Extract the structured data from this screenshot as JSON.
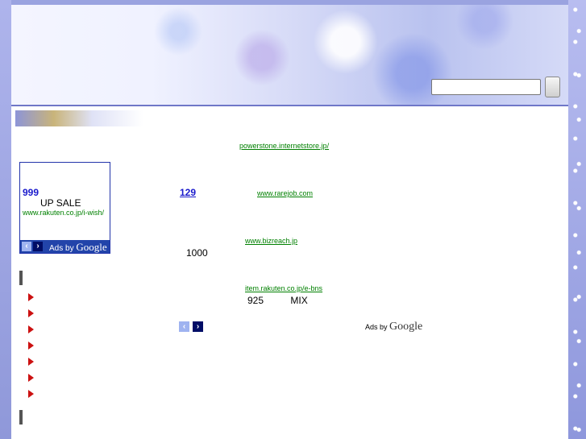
{
  "search": {
    "value": "",
    "placeholder": ""
  },
  "sidebar_ad": {
    "price": "999",
    "sale": "UP SALE",
    "url": "www.rakuten.co.jp/i-wish/",
    "prev_icon": "‹",
    "next_icon": "›",
    "ads_by": "Ads by",
    "google": "Google"
  },
  "menu": {
    "item_count": 7
  },
  "ads": [
    {
      "title": "",
      "url": "powerstone.internetstore.jp/",
      "desc": ""
    },
    {
      "title": "129",
      "url": "www.rarejob.com",
      "desc": ""
    },
    {
      "title": "",
      "url": "www.bizreach.jp",
      "desc": "1000"
    },
    {
      "title": "",
      "url": "item.rakuten.co.jp/e-bns",
      "desc": "925          MIX"
    }
  ],
  "ads_footer": {
    "prev_icon": "‹",
    "next_icon": "›",
    "ads_by": "Ads by",
    "google": "Google"
  },
  "colors": {
    "link": "#1a1acc",
    "url": "#008000",
    "arrow": "#cc1111",
    "ad_border": "#2233aa"
  }
}
